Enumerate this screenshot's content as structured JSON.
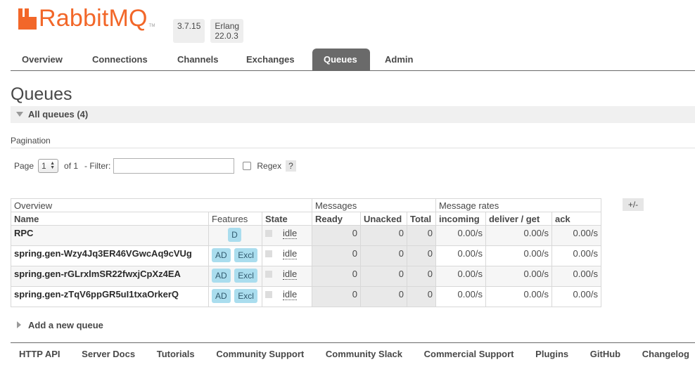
{
  "header": {
    "logo_text": "RabbitMQ",
    "logo_tm": "TM",
    "version": "3.7.15",
    "erlang": "Erlang 22.0.3"
  },
  "tabs": [
    {
      "label": "Overview",
      "active": false
    },
    {
      "label": "Connections",
      "active": false
    },
    {
      "label": "Channels",
      "active": false
    },
    {
      "label": "Exchanges",
      "active": false
    },
    {
      "label": "Queues",
      "active": true
    },
    {
      "label": "Admin",
      "active": false
    }
  ],
  "page_title": "Queues",
  "section": {
    "title": "All queues (4)"
  },
  "pagination": {
    "label": "Pagination",
    "page_label": "Page",
    "page_value": "1",
    "of_label": "of 1",
    "filter_label": "- Filter:",
    "filter_value": "",
    "regex_label": "Regex",
    "help": "?"
  },
  "table": {
    "plusminus": "+/-",
    "groups": {
      "overview": "Overview",
      "messages": "Messages",
      "rates": "Message rates"
    },
    "columns": {
      "name": "Name",
      "features": "Features",
      "state": "State",
      "ready": "Ready",
      "unacked": "Unacked",
      "total": "Total",
      "incoming": "incoming",
      "deliver": "deliver / get",
      "ack": "ack"
    },
    "rows": [
      {
        "name": "RPC",
        "features": [
          "D"
        ],
        "state": "idle",
        "ready": "0",
        "unacked": "0",
        "total": "0",
        "incoming": "0.00/s",
        "deliver": "0.00/s",
        "ack": "0.00/s"
      },
      {
        "name": "spring.gen-Wzy4Jq3ER46VGwcAq9cVUg",
        "features": [
          "AD",
          "Excl"
        ],
        "state": "idle",
        "ready": "0",
        "unacked": "0",
        "total": "0",
        "incoming": "0.00/s",
        "deliver": "0.00/s",
        "ack": "0.00/s"
      },
      {
        "name": "spring.gen-rGLrxlmSR22fwxjCpXz4EA",
        "features": [
          "AD",
          "Excl"
        ],
        "state": "idle",
        "ready": "0",
        "unacked": "0",
        "total": "0",
        "incoming": "0.00/s",
        "deliver": "0.00/s",
        "ack": "0.00/s"
      },
      {
        "name": "spring.gen-zTqV6ppGR5uI1txaOrkerQ",
        "features": [
          "AD",
          "Excl"
        ],
        "state": "idle",
        "ready": "0",
        "unacked": "0",
        "total": "0",
        "incoming": "0.00/s",
        "deliver": "0.00/s",
        "ack": "0.00/s"
      }
    ]
  },
  "add_queue": "Add a new queue",
  "footer": [
    "HTTP API",
    "Server Docs",
    "Tutorials",
    "Community Support",
    "Community Slack",
    "Commercial Support",
    "Plugins",
    "GitHub",
    "Changelog"
  ],
  "colors": {
    "brand": "#f26729",
    "tab_active": "#6a6a6a",
    "feature_badge": "#aaddee"
  }
}
